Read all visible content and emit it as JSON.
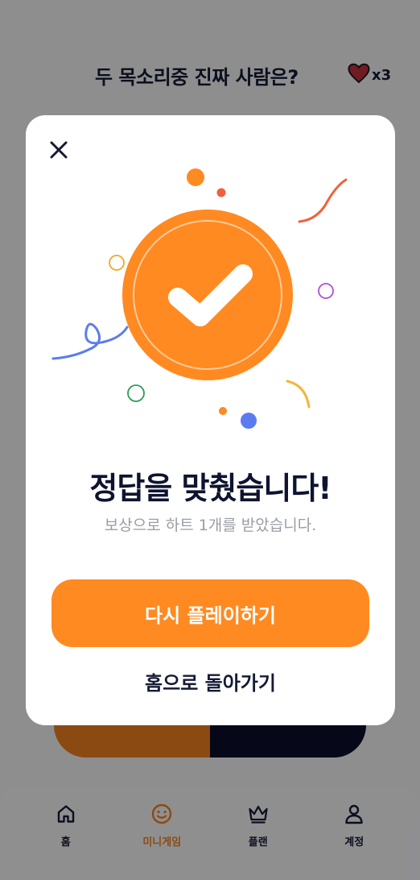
{
  "header": {
    "question": "두 목소리중 진짜 사람은?",
    "hearts_count": "x3",
    "heart_icon": "heart-icon"
  },
  "modal": {
    "close_icon": "close-icon",
    "badge_icon": "check-badge-icon",
    "title": "정답을 맞췄습니다!",
    "subtitle": "보상으로 하트 1개를 받았습니다.",
    "primary_button": "다시 플레이하기",
    "secondary_button": "홈으로 돌아가기"
  },
  "nav": {
    "items": [
      {
        "label": "홈",
        "icon": "home-icon",
        "active": false
      },
      {
        "label": "미니게임",
        "icon": "smile-icon",
        "active": true
      },
      {
        "label": "플랜",
        "icon": "crown-icon",
        "active": false
      },
      {
        "label": "계정",
        "icon": "user-icon",
        "active": false
      }
    ]
  },
  "colors": {
    "accent": "#ff8a21",
    "text_dark": "#141a33",
    "heart": "#c62f3f",
    "answer_b": "#0b0d2a"
  }
}
